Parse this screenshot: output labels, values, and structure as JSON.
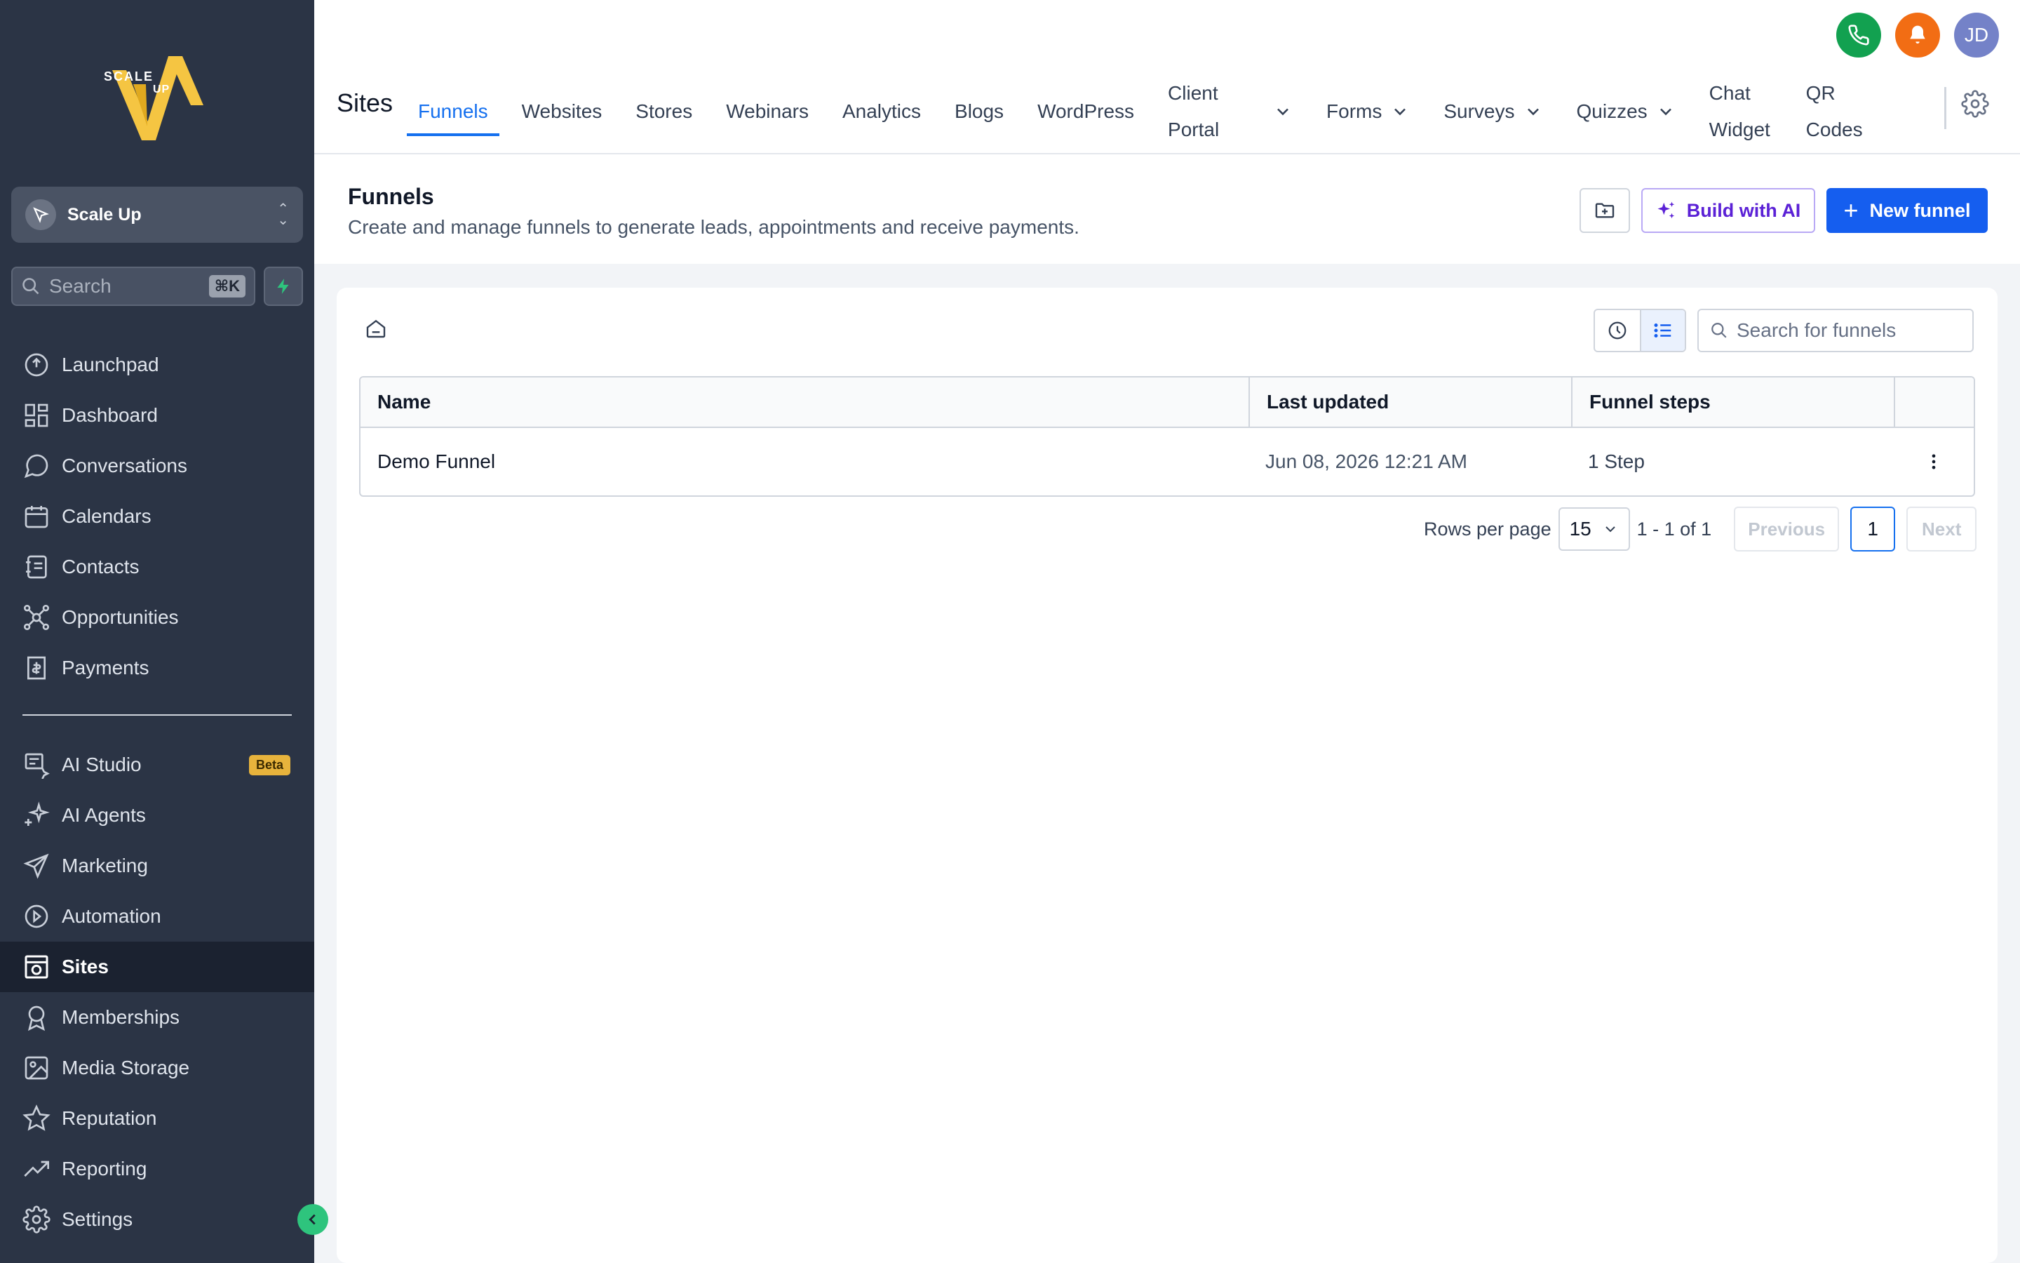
{
  "sidebar": {
    "account_name": "Scale Up",
    "logo_text": [
      "SCALE",
      "UP"
    ],
    "search_placeholder": "Search",
    "search_shortcut": "⌘K",
    "items_top": [
      {
        "label": "Launchpad",
        "icon": "rocket-icon"
      },
      {
        "label": "Dashboard",
        "icon": "grid-icon"
      },
      {
        "label": "Conversations",
        "icon": "chat-icon"
      },
      {
        "label": "Calendars",
        "icon": "calendar-icon"
      },
      {
        "label": "Contacts",
        "icon": "contacts-icon"
      },
      {
        "label": "Opportunities",
        "icon": "network-icon"
      },
      {
        "label": "Payments",
        "icon": "receipt-icon"
      }
    ],
    "items_bottom": [
      {
        "label": "AI Studio",
        "icon": "ai-studio-icon",
        "badge": "Beta"
      },
      {
        "label": "AI Agents",
        "icon": "sparkle-icon"
      },
      {
        "label": "Marketing",
        "icon": "send-icon"
      },
      {
        "label": "Automation",
        "icon": "automation-icon"
      },
      {
        "label": "Sites",
        "icon": "sites-icon",
        "active": true
      },
      {
        "label": "Memberships",
        "icon": "award-icon"
      },
      {
        "label": "Media Storage",
        "icon": "image-icon"
      },
      {
        "label": "Reputation",
        "icon": "star-icon"
      },
      {
        "label": "Reporting",
        "icon": "trend-icon"
      },
      {
        "label": "Settings",
        "icon": "gear-icon"
      }
    ]
  },
  "topbar": {
    "title": "Sites",
    "tabs": [
      {
        "label": "Funnels",
        "active": true
      },
      {
        "label": "Websites"
      },
      {
        "label": "Stores"
      },
      {
        "label": "Webinars"
      },
      {
        "label": "Analytics"
      },
      {
        "label": "Blogs"
      },
      {
        "label": "WordPress"
      },
      {
        "label": "Client Portal",
        "dropdown": true
      },
      {
        "label": "Forms",
        "dropdown": true
      },
      {
        "label": "Surveys",
        "dropdown": true
      },
      {
        "label": "Quizzes",
        "dropdown": true
      },
      {
        "label": "Chat Widget"
      },
      {
        "label": "QR Codes"
      }
    ],
    "avatar_initials": "JD"
  },
  "page": {
    "title": "Funnels",
    "subtitle": "Create and manage funnels to generate leads, appointments and receive payments.",
    "build_ai_label": "Build with AI",
    "new_funnel_label": "New funnel",
    "search_placeholder": "Search for funnels"
  },
  "table": {
    "columns": [
      "Name",
      "Last updated",
      "Funnel steps"
    ],
    "rows": [
      {
        "name": "Demo Funnel",
        "last_updated": "Jun 08, 2026 12:21 AM",
        "steps": "1 Step"
      }
    ]
  },
  "pagination": {
    "rows_per_page_label": "Rows per page",
    "rows_per_page": "15",
    "range": "1 - 1 of 1",
    "previous": "Previous",
    "page": "1",
    "next": "Next"
  },
  "colors": {
    "sidebar_bg": "#2b3445",
    "accent_blue": "#1570ef",
    "primary_button": "#155eef",
    "ai_purple": "#5b21d6",
    "phone_green": "#12a150",
    "bell_orange": "#f26d14",
    "avatar_purple": "#7482c8",
    "beta_badge": "#e7b33c"
  }
}
